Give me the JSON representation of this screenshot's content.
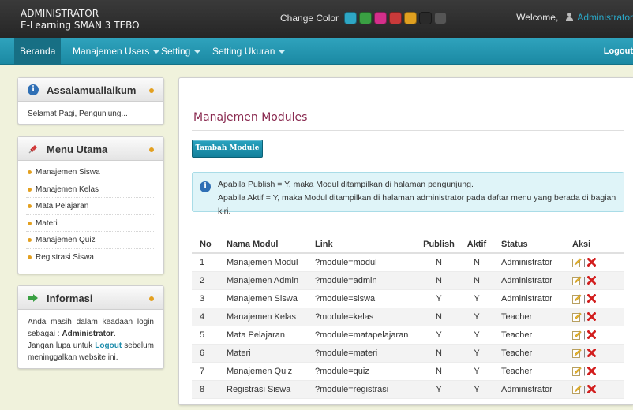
{
  "header": {
    "role": "ADMINISTRATOR",
    "site_name": "E-Learning SMAN 3 TEBO",
    "change_color_label": "Change Color",
    "swatches": [
      "#2ea6c4",
      "#3aa043",
      "#d42f8a",
      "#c83a3a",
      "#e0a020",
      "#2a2a2a",
      "#555555"
    ],
    "welcome_label": "Welcome,",
    "user_name": "Administrator"
  },
  "nav": {
    "items": [
      "Beranda",
      "Manajemen Users",
      "Setting",
      "Setting Ukuran"
    ],
    "logout": "Logout"
  },
  "sidebar": {
    "greeting": {
      "title": "Assalamuallaikum",
      "text": "Selamat Pagi, Pengunjung..."
    },
    "menu": {
      "title": "Menu Utama",
      "items": [
        "Manajemen Siswa",
        "Manajemen Kelas",
        "Mata Pelajaran",
        "Materi",
        "Manajemen Quiz",
        "Registrasi Siswa"
      ]
    },
    "info": {
      "title": "Informasi",
      "line1": "Anda masih dalam keadaan login sebagai :",
      "role": "Administrator",
      "line2a": "Jangan lupa untuk",
      "logout_word": "Logout",
      "line2b": "sebelum meninggalkan website ini."
    }
  },
  "main": {
    "title": "Manajemen Modules",
    "add_button": "Tambah Module",
    "notice_line1": "Apabila Publish = Y, maka Modul ditampilkan di halaman pengunjung.",
    "notice_line2": "Apabila Aktif = Y, maka Modul ditampilkan di halaman administrator pada daftar menu yang berada di bagian kiri.",
    "table": {
      "headers": [
        "No",
        "Nama Modul",
        "Link",
        "Publish",
        "Aktif",
        "Status",
        "Aksi"
      ],
      "rows": [
        {
          "no": "1",
          "name": "Manajemen Modul",
          "link": "?module=modul",
          "publish": "N",
          "aktif": "N",
          "status": "Administrator"
        },
        {
          "no": "2",
          "name": "Manajemen Admin",
          "link": "?module=admin",
          "publish": "N",
          "aktif": "N",
          "status": "Administrator"
        },
        {
          "no": "3",
          "name": "Manajemen Siswa",
          "link": "?module=siswa",
          "publish": "Y",
          "aktif": "Y",
          "status": "Administrator"
        },
        {
          "no": "4",
          "name": "Manajemen Kelas",
          "link": "?module=kelas",
          "publish": "N",
          "aktif": "Y",
          "status": "Teacher"
        },
        {
          "no": "5",
          "name": "Mata Pelajaran",
          "link": "?module=matapelajaran",
          "publish": "Y",
          "aktif": "Y",
          "status": "Teacher"
        },
        {
          "no": "6",
          "name": "Materi",
          "link": "?module=materi",
          "publish": "N",
          "aktif": "Y",
          "status": "Teacher"
        },
        {
          "no": "7",
          "name": "Manajemen Quiz",
          "link": "?module=quiz",
          "publish": "N",
          "aktif": "Y",
          "status": "Teacher"
        },
        {
          "no": "8",
          "name": "Registrasi Siswa",
          "link": "?module=registrasi",
          "publish": "Y",
          "aktif": "Y",
          "status": "Administrator"
        }
      ],
      "action_separator": "|"
    }
  }
}
